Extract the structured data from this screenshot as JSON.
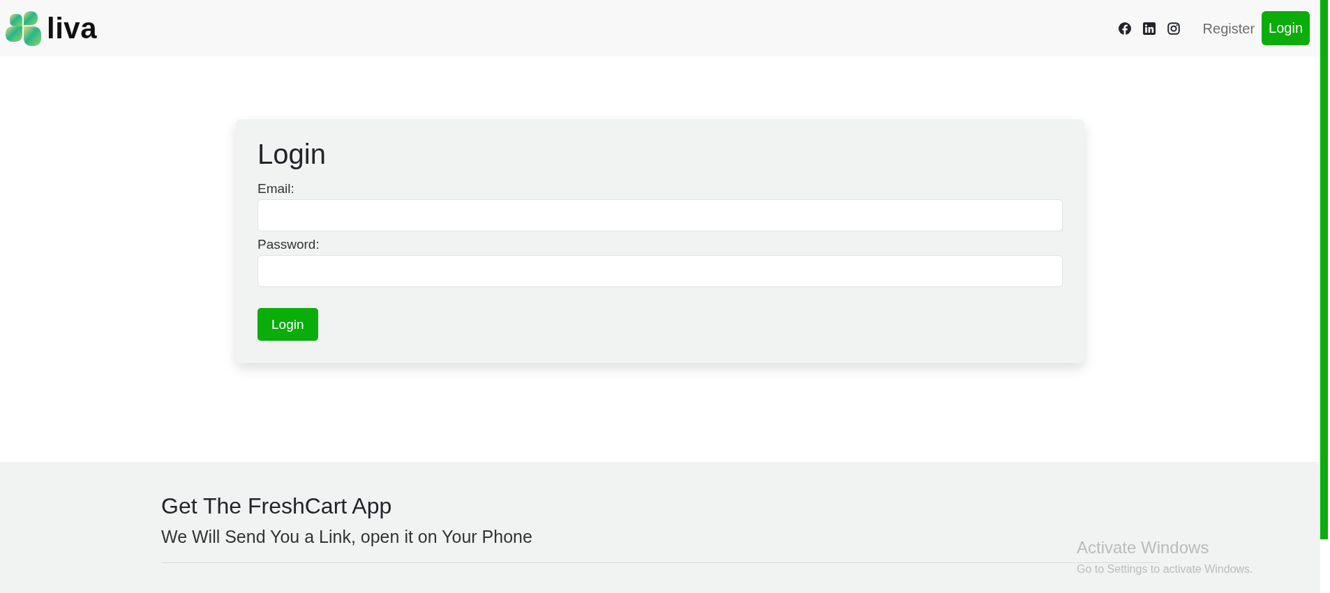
{
  "navbar": {
    "brand": "liva",
    "social_links": [
      {
        "kind": "facebook"
      },
      {
        "kind": "linkedin"
      },
      {
        "kind": "instagram"
      }
    ],
    "links": [
      {
        "label": "Register",
        "kind": "link"
      },
      {
        "label": "Login",
        "kind": "button"
      }
    ]
  },
  "login_form": {
    "title": "Login",
    "fields": [
      {
        "label": "Email:"
      },
      {
        "label": "Password:"
      }
    ],
    "submit": "Login"
  },
  "footer": {
    "title": "Get The FreshCart App",
    "subtitle": "We Will Send You a Link, open it on Your Phone"
  },
  "os_notice": {
    "title": "Activate Windows",
    "subtitle": "Go to Settings to activate Windows."
  }
}
